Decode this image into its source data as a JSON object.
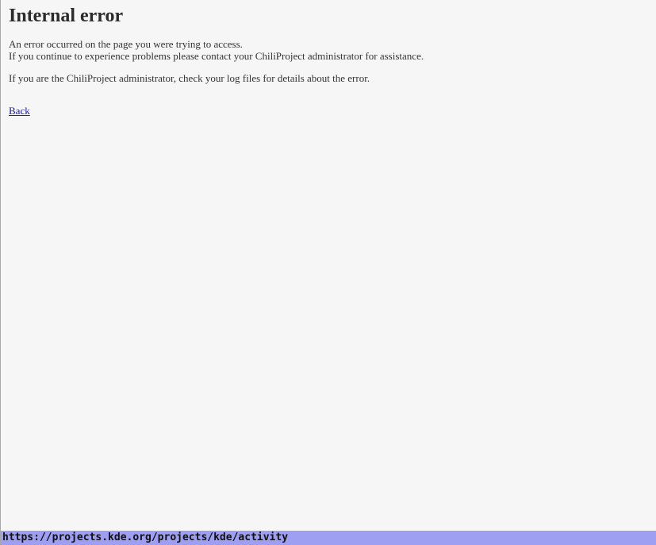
{
  "page": {
    "title": "Internal error",
    "message_lines": [
      "An error occurred on the page you were trying to access.",
      "If you continue to experience problems please contact your ChiliProject administrator for assistance."
    ],
    "admin_note": "If you are the ChiliProject administrator, check your log files for details about the error.",
    "back_link": "Back"
  },
  "statusbar": {
    "url": "https://projects.kde.org/projects/kde/activity"
  },
  "colors": {
    "background": "#f6f6f6",
    "link": "#1a1aa6",
    "statusbar": "#9e9ef2"
  }
}
